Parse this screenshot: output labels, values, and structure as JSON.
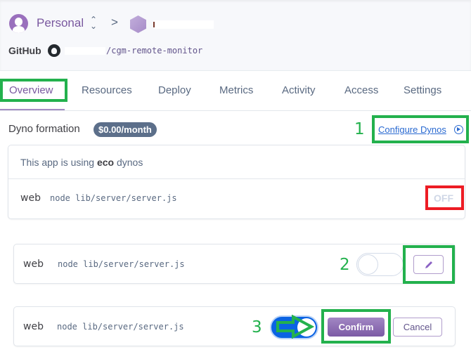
{
  "header": {
    "account": "Personal",
    "breadcrumb_separator": ">",
    "app_name_redacted": true,
    "github_label": "GitHub",
    "repo_path": "/cgm-remote-monitor"
  },
  "tabs": [
    {
      "label": "Overview",
      "active": true
    },
    {
      "label": "Resources",
      "active": false
    },
    {
      "label": "Deploy",
      "active": false
    },
    {
      "label": "Metrics",
      "active": false
    },
    {
      "label": "Activity",
      "active": false
    },
    {
      "label": "Access",
      "active": false
    },
    {
      "label": "Settings",
      "active": false
    }
  ],
  "dyno_formation": {
    "title": "Dyno formation",
    "price": "$0.00/month",
    "configure_link": "Configure Dynos",
    "eco_prefix": "This app is using ",
    "eco_tier": "eco",
    "eco_suffix": " dynos",
    "process_type": "web",
    "command": "node lib/server/server.js",
    "status": "OFF"
  },
  "edit_row": {
    "process_type": "web",
    "command": "node lib/server/server.js",
    "toggle_on": false
  },
  "confirm_row": {
    "process_type": "web",
    "command": "node lib/server/server.js",
    "toggle_on": true,
    "confirm_label": "Confirm",
    "cancel_label": "Cancel"
  },
  "annotations": {
    "step1": "1",
    "step2": "2",
    "step3": "3",
    "highlight_color": "#23b14d",
    "alert_color": "#ed1c24"
  },
  "colors": {
    "brand_purple": "#79589f",
    "link_blue": "#2a6ad1",
    "toggle_blue": "#0a63e3",
    "badge_slate": "#5c6f8a"
  }
}
